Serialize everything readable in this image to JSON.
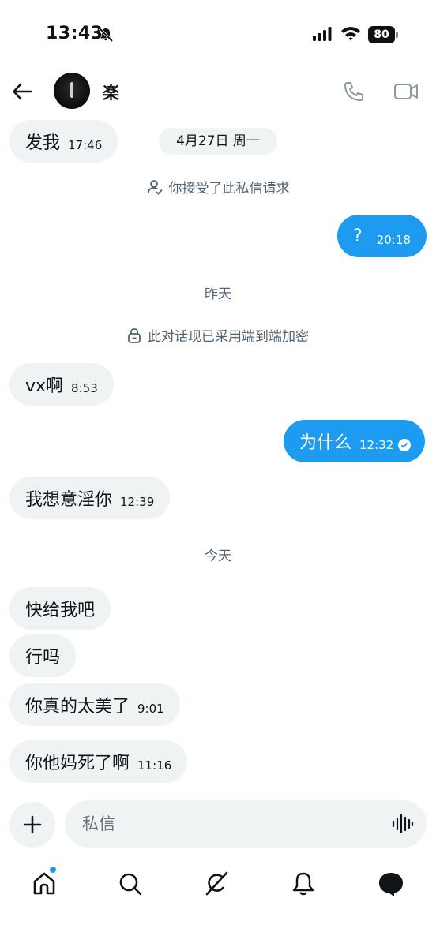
{
  "status_bar": {
    "time": "13:43",
    "battery": "80"
  },
  "header": {
    "contact_name": "楽"
  },
  "date_pill": "4月27日 周一",
  "system_notes": {
    "accepted": "你接受了此私信请求",
    "encrypted": "此对话现已采用端到端加密"
  },
  "day_separators": {
    "yesterday": "昨天",
    "today": "今天"
  },
  "messages": [
    {
      "direction": "in",
      "text": "发我",
      "time": "17:46"
    },
    {
      "direction": "out",
      "text": "?",
      "time": "20:18"
    },
    {
      "direction": "in",
      "text": "vx啊",
      "time": "8:53"
    },
    {
      "direction": "out",
      "text": "为什么",
      "time": "12:32",
      "read": true
    },
    {
      "direction": "in",
      "text": "我想意淫你",
      "time": "12:39"
    },
    {
      "direction": "in",
      "text": "快给我吧",
      "time": ""
    },
    {
      "direction": "in",
      "text": "行吗",
      "time": ""
    },
    {
      "direction": "in",
      "text": "你真的太美了",
      "time": "9:01"
    },
    {
      "direction": "in",
      "text": "你他妈死了啊",
      "time": "11:16"
    }
  ],
  "composer": {
    "placeholder": "私信"
  },
  "nav": {
    "items": [
      "home-icon",
      "search-icon",
      "grok-icon",
      "notifications-icon",
      "messages-icon"
    ],
    "home_has_badge": true
  },
  "colors": {
    "accent": "#1d9bf0",
    "incoming_bubble": "#eff3f4",
    "muted_text": "#536471"
  }
}
